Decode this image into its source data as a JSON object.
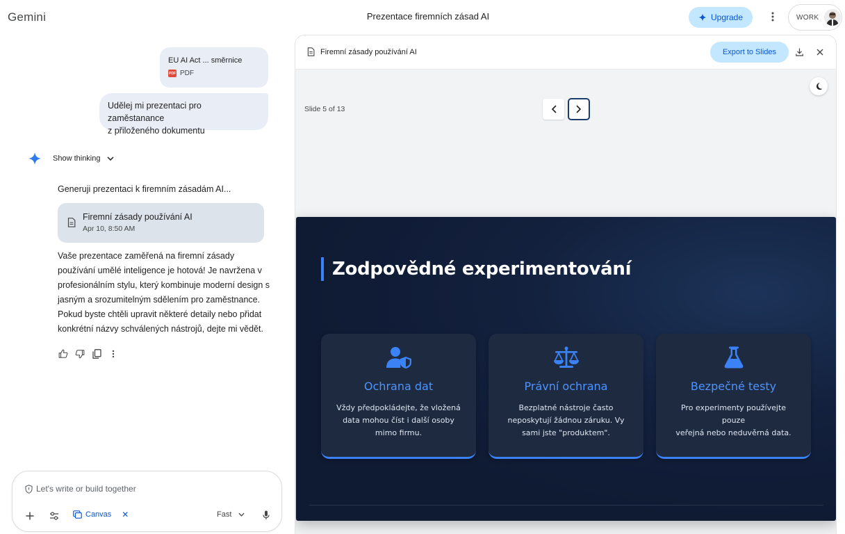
{
  "app": {
    "brand": "Gemini",
    "title": "Prezentace firemních zásad AI"
  },
  "header": {
    "upgrade_label": "Upgrade",
    "account_label": "WORK"
  },
  "chat": {
    "attachment": {
      "name": "EU AI Act ... směrnice",
      "type": "PDF"
    },
    "user_message_line1": "Udělej mi prezentaci pro zaměstanance",
    "user_message_line2": "z přiloženého dokumentu",
    "show_thinking": "Show thinking",
    "generating_text": "Generuji prezentaci k firemním zásadám AI...",
    "artifact": {
      "title": "Firemní zásady používání AI",
      "date": "Apr 10, 8:50 AM"
    },
    "response_lines": [
      "Vaše prezentace zaměřená na firemní zásady",
      "používání umělé inteligence je hotová! Je navržena v",
      "profesionálním stylu, který kombinuje moderní design s",
      "jasným a srozumitelným sdělením pro zaměstnance.",
      "Pokud byste chtěli upravit některé detaily nebo přidat",
      "konkrétní názvy schválených nástrojů, dejte mi vědět."
    ]
  },
  "composer": {
    "placeholder": "Let's write or build together",
    "canvas_label": "Canvas",
    "mode": "Fast"
  },
  "panel": {
    "title": "Firemní zásady používání AI",
    "export_label": "Export to Slides",
    "slide_counter": "Slide 5 of 13"
  },
  "slide": {
    "heading": "Zodpovědné experimentování",
    "accent_color": "#3b82f6",
    "cards": [
      {
        "icon": "user-shield-icon",
        "title": "Ochrana dat",
        "body_lines": [
          "Vždy předpokládejte, že vložená",
          "data mohou číst i další osoby",
          "mimo firmu."
        ]
      },
      {
        "icon": "scale-icon",
        "title": "Právní ochrana",
        "body_lines": [
          "Bezplatné nástroje často",
          "neposkytují žádnou záruku. Vy",
          "sami jste \"produktem\"."
        ]
      },
      {
        "icon": "flask-icon",
        "title": "Bezpečné testy",
        "body_lines": [
          "Pro experimenty používejte pouze",
          "veřejná nebo neduvěrná data."
        ]
      }
    ]
  }
}
